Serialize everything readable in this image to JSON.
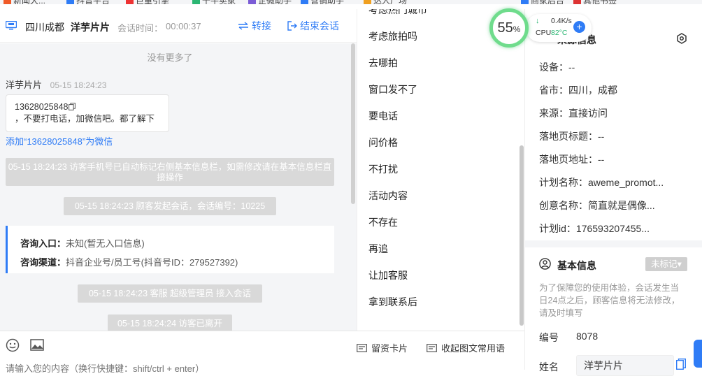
{
  "bookmarks": [
    "新闻大...",
    "抖音平台",
    "巨量引擎",
    "千牛卖家",
    "企微助手",
    "营销助手",
    "达人广场",
    "商家后台",
    "其他书签"
  ],
  "chat_header": {
    "location": "四川成都",
    "visitor_name": "洋芋片片",
    "session_time_label": "会话时间：",
    "session_time": "00:00:37",
    "transfer_label": "转接",
    "end_label": "结束会话"
  },
  "chat": {
    "no_more": "没有更多了",
    "sender": "洋芋片片",
    "sender_time": "05-15 18:24:23",
    "message_phone": "13628025848",
    "message_text": "，不要打电话，加微信吧。都了解下",
    "add_wechat": "添加“13628025848”为微信",
    "system1": "05-15 18:24:23 访客手机号已自动标记右侧基本信息栏，如需修改请在基本信息栏直接操作",
    "system2": "05-15 18:24:23 顾客发起会话，会话编号：10225",
    "entry_label": "咨询入口：",
    "entry_value": "未知(暂无入口信息)",
    "channel_label": "咨询渠道：",
    "channel_value": "抖音企业号/员工号(抖音号ID：279527392)",
    "system3": "05-15 18:24:23 客服 超级管理员 接入会话",
    "system4": "05-15 18:24:24 访客已离开"
  },
  "composer": {
    "leave_card": "留资卡片",
    "collapse_phrases": "收起图文常用语",
    "placeholder": "请输入您的内容（换行快捷键：shift/ctrl + enter）"
  },
  "quick_replies": [
    "考虑热门城市",
    "考虑旅拍吗",
    "去哪拍",
    "窗口发不了",
    "要电话",
    "问价格",
    "不打扰",
    "活动内容",
    "不存在",
    "再追",
    "让加客服",
    "拿到联系后"
  ],
  "source_info": {
    "title": "来源信息",
    "fields": [
      {
        "k": "设备：",
        "v": "--"
      },
      {
        "k": "省市：",
        "v": "四川，成都"
      },
      {
        "k": "来源：",
        "v": "直接访问"
      },
      {
        "k": "落地页标题：",
        "v": "--"
      },
      {
        "k": "落地页地址：",
        "v": "--"
      },
      {
        "k": "计划名称：",
        "v": "aweme_promot..."
      },
      {
        "k": "创意名称：",
        "v": "简直就是偶像..."
      },
      {
        "k": "计划id：",
        "v": "176593207455..."
      }
    ]
  },
  "basic_info": {
    "title": "基本信息",
    "tag_select": "未标记▾",
    "note": "为了保障您的使用体验，会话发生当日24点之后，顾客信息将无法修改，请及时填写",
    "number_label": "编号",
    "number_value": "8078",
    "name_label": "姓名",
    "name_value": "洋芋片片"
  },
  "monitor": {
    "percent": "55",
    "percent_unit": "%",
    "net_speed": "0.4K/s",
    "cpu_label": "CPU",
    "cpu_temp": "82°C",
    "plus": "+"
  },
  "colors": {
    "accent": "#2f7cf6",
    "green": "#2bb673",
    "system_msg": "#d9d9d9"
  }
}
